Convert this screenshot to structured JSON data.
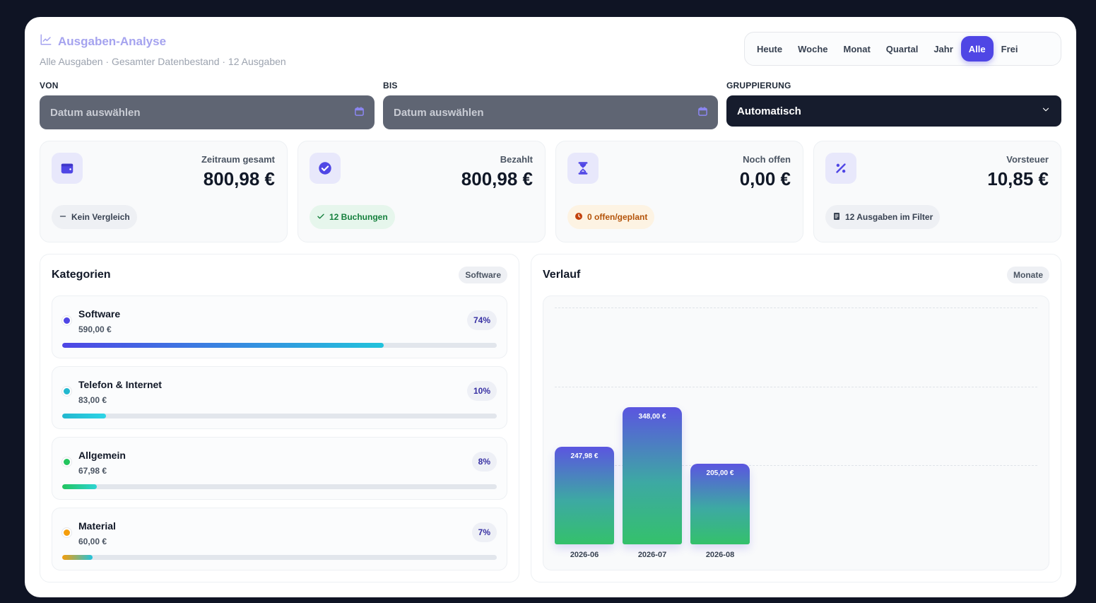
{
  "header": {
    "title": "Ausgaben-Analyse",
    "subtitle": "Alle Ausgaben · Gesamter Datenbestand · 12 Ausgaben",
    "title_icon": "line-chart-icon"
  },
  "range_tabs": [
    {
      "label": "Heute",
      "active": false
    },
    {
      "label": "Woche",
      "active": false
    },
    {
      "label": "Monat",
      "active": false
    },
    {
      "label": "Quartal",
      "active": false
    },
    {
      "label": "Jahr",
      "active": false
    },
    {
      "label": "Alle",
      "active": true
    },
    {
      "label": "Frei",
      "active": false
    }
  ],
  "filters": {
    "from_label": "VON",
    "from_placeholder": "Datum auswählen",
    "to_label": "BIS",
    "to_placeholder": "Datum auswählen",
    "group_label": "GRUPPIERUNG",
    "group_value": "Automatisch"
  },
  "stats": [
    {
      "label": "Zeitraum gesamt",
      "value": "800,98 €",
      "icon": "wallet-icon",
      "badge": "Kein Vergleich",
      "badge_icon": "minus-icon",
      "badge_color": "#374151",
      "badge_bg": "#eef0f4"
    },
    {
      "label": "Bezahlt",
      "value": "800,98 €",
      "icon": "check-circle-icon",
      "badge": "12 Buchungen",
      "badge_icon": "check-icon",
      "badge_color": "#15803d",
      "badge_bg": "#e6f6ec"
    },
    {
      "label": "Noch offen",
      "value": "0,00 €",
      "icon": "hourglass-icon",
      "badge": "0 offen/geplant",
      "badge_icon": "clock-icon",
      "badge_color": "#b45309",
      "badge_bg": "#fdf3e3"
    },
    {
      "label": "Vorsteuer",
      "value": "10,85 €",
      "icon": "percent-icon",
      "badge": "12 Ausgaben im Filter",
      "badge_icon": "document-icon",
      "badge_color": "#374151",
      "badge_bg": "#eef0f4"
    }
  ],
  "categories": {
    "title": "Kategorien",
    "pill": "Software",
    "items": [
      {
        "name": "Software",
        "amount": "590,00 €",
        "percent_label": "74%",
        "share": 0.74,
        "dot": "#4f46e5",
        "gradient": "linear-gradient(to right, #4f46e5, #22c3dc)"
      },
      {
        "name": "Telefon & Internet",
        "amount": "83,00 €",
        "percent_label": "10%",
        "share": 0.1,
        "dot": "#22b8cf",
        "gradient": "linear-gradient(to right, #22b8cf, #2dd4e6)"
      },
      {
        "name": "Allgemein",
        "amount": "67,98 €",
        "percent_label": "8%",
        "share": 0.08,
        "dot": "#22c55e",
        "gradient": "linear-gradient(to right, #22c55e, #2dd4d4)"
      },
      {
        "name": "Material",
        "amount": "60,00 €",
        "percent_label": "7%",
        "share": 0.07,
        "dot": "#f59e0b",
        "gradient": "linear-gradient(to right, #f59e0b, #22c3dc)"
      }
    ]
  },
  "history": {
    "title": "Verlauf",
    "pill": "Monate"
  },
  "chart_data": {
    "type": "bar",
    "categories": [
      "2026-06",
      "2026-07",
      "2026-08"
    ],
    "values": [
      247.98,
      348.0,
      205.0
    ],
    "value_labels": [
      "247,98 €",
      "348,00 €",
      "205,00 €"
    ],
    "ylim": [
      0,
      600
    ],
    "grid": true
  }
}
